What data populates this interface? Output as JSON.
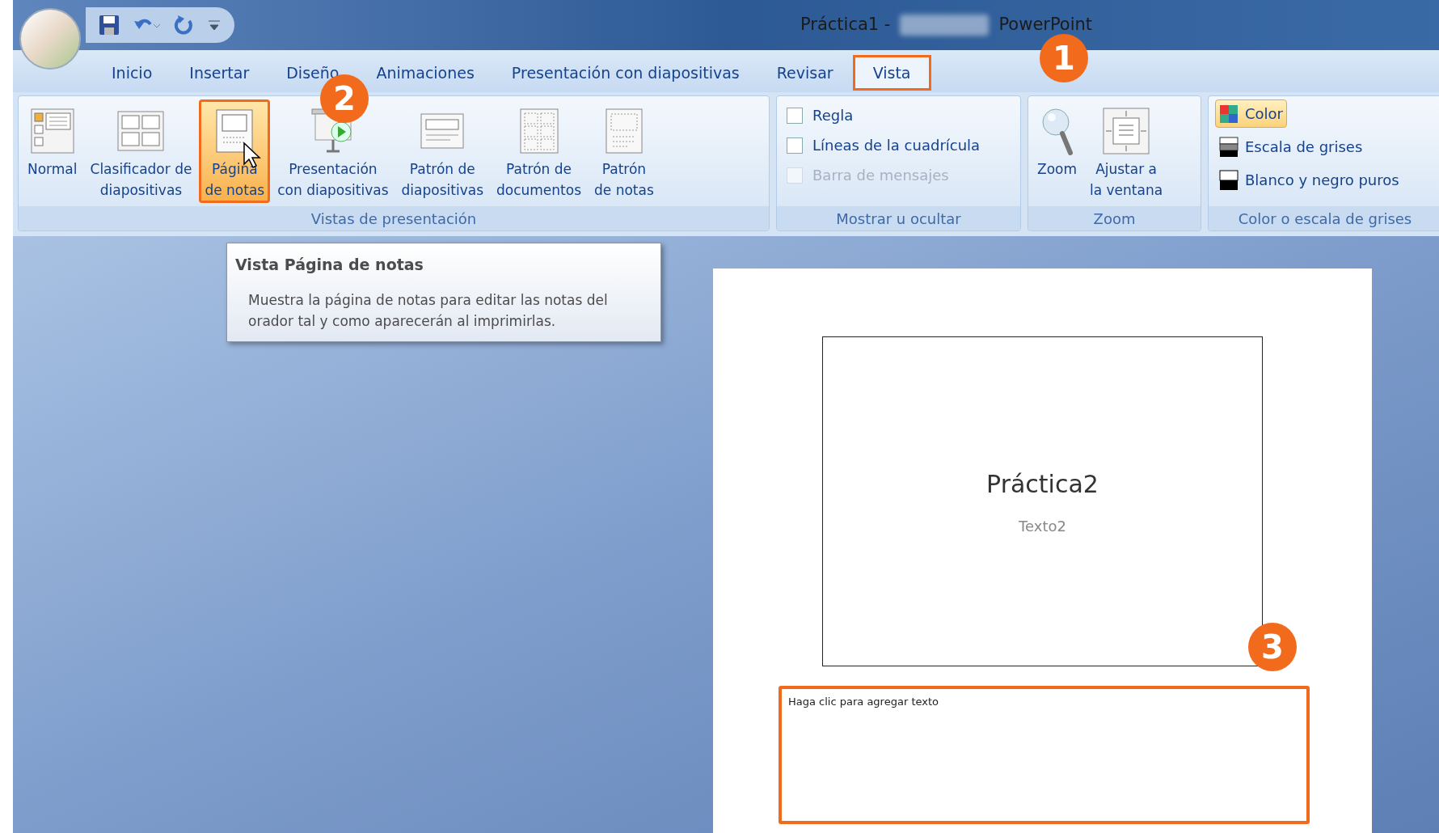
{
  "window": {
    "title_left": "Práctica1 -",
    "title_right": "PowerPoint"
  },
  "tabs": [
    {
      "label": "Inicio",
      "selected": false
    },
    {
      "label": "Insertar",
      "selected": false
    },
    {
      "label": "Diseño",
      "selected": false
    },
    {
      "label": "Animaciones",
      "selected": false
    },
    {
      "label": "Presentación con diapositivas",
      "selected": false
    },
    {
      "label": "Revisar",
      "selected": false
    },
    {
      "label": "Vista",
      "selected": true
    }
  ],
  "ribbon": {
    "groups": [
      {
        "kind": "buttons",
        "label": "Vistas de presentación",
        "buttons": [
          {
            "lines": [
              "Normal"
            ],
            "selected": false
          },
          {
            "lines": [
              "Clasificador de",
              "diapositivas"
            ],
            "selected": false
          },
          {
            "lines": [
              "Página",
              "de notas"
            ],
            "selected": true
          },
          {
            "lines": [
              "Presentación",
              "con diapositivas"
            ],
            "selected": false
          },
          {
            "lines": [
              "Patrón de",
              "diapositivas"
            ],
            "selected": false
          },
          {
            "lines": [
              "Patrón de",
              "documentos"
            ],
            "selected": false
          },
          {
            "lines": [
              "Patrón",
              "de notas"
            ],
            "selected": false
          }
        ]
      },
      {
        "kind": "checks",
        "label": "Mostrar u ocultar",
        "items": [
          {
            "label": "Regla",
            "checked": false,
            "disabled": false
          },
          {
            "label": "Líneas de la cuadrícula",
            "checked": false,
            "disabled": false
          },
          {
            "label": "Barra de mensajes",
            "checked": false,
            "disabled": true
          }
        ]
      },
      {
        "kind": "buttons",
        "label": "Zoom",
        "buttons": [
          {
            "lines": [
              "Zoom"
            ],
            "selected": false
          },
          {
            "lines": [
              "Ajustar a",
              "la ventana"
            ],
            "selected": false
          }
        ]
      },
      {
        "kind": "options",
        "label": "Color o escala de grises",
        "items": [
          {
            "label": "Color",
            "selected": true
          },
          {
            "label": "Escala de grises",
            "selected": false
          },
          {
            "label": "Blanco y negro puros",
            "selected": false
          }
        ]
      }
    ]
  },
  "tooltip": {
    "title": "Vista Página de notas",
    "body": "Muestra la página de notas para editar las notas del orador tal y como aparecerán al imprimirlas."
  },
  "notes_page": {
    "slide_title": "Práctica2",
    "slide_subtitle": "Texto2",
    "notes_placeholder": "Haga clic para agregar texto"
  },
  "callouts": [
    {
      "number": "1"
    },
    {
      "number": "2"
    },
    {
      "number": "3"
    }
  ]
}
